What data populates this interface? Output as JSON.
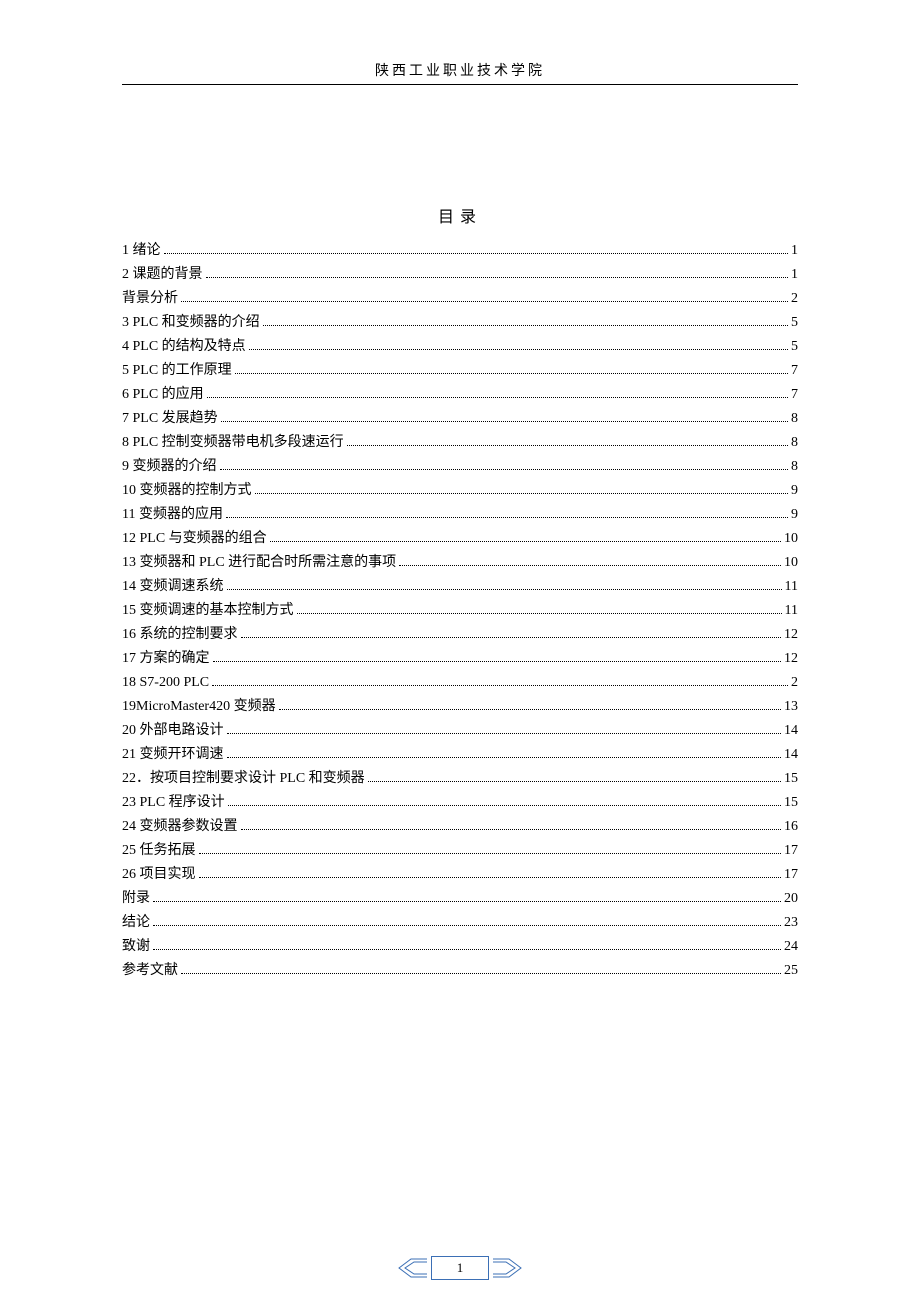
{
  "header": "陕西工业职业技术学院",
  "toc_title": "目录",
  "page_number": "1",
  "toc": [
    {
      "text": "1 绪论",
      "page": "1"
    },
    {
      "text": "2 课题的背景",
      "page": "1"
    },
    {
      "text": "背景分析",
      "page": "2"
    },
    {
      "text": "3 PLC 和变频器的介绍",
      "page": "5"
    },
    {
      "text": "4 PLC 的结构及特点",
      "page": "5"
    },
    {
      "text": "5 PLC 的工作原理",
      "page": "7"
    },
    {
      "text": "6 PLC 的应用",
      "page": "7"
    },
    {
      "text": "7 PLC 发展趋势",
      "page": "8"
    },
    {
      "text": "8 PLC 控制变频器带电机多段速运行",
      "page": "8"
    },
    {
      "text": "9 变频器的介绍",
      "page": "8"
    },
    {
      "text": "10 变频器的控制方式",
      "page": "9"
    },
    {
      "text": "11 变频器的应用",
      "page": "9"
    },
    {
      "text": "12 PLC 与变频器的组合",
      "page": "10"
    },
    {
      "text": "13 变频器和 PLC 进行配合时所需注意的事项",
      "page": "10"
    },
    {
      "text": "14 变频调速系统",
      "page": "11"
    },
    {
      "text": "15 变频调速的基本控制方式",
      "page": "11"
    },
    {
      "text": "16 系统的控制要求",
      "page": "12"
    },
    {
      "text": "17 方案的确定",
      "page": "12"
    },
    {
      "text": "18 S7-200 PLC",
      "page": "2"
    },
    {
      "text": "19MicroMaster420 变频器",
      "page": "13"
    },
    {
      "text": "20 外部电路设计",
      "page": "14"
    },
    {
      "text": "21 变频开环调速",
      "page": "14"
    },
    {
      "text": "22．按项目控制要求设计 PLC 和变频器",
      "page": "15"
    },
    {
      "text": "23 PLC 程序设计",
      "page": "15"
    },
    {
      "text": "24 变频器参数设置",
      "page": "16"
    },
    {
      "text": "25 任务拓展",
      "page": "17"
    },
    {
      "text": "26 项目实现",
      "page": "17"
    },
    {
      "text": "附录",
      "page": "20"
    },
    {
      "text": "结论",
      "page": "23"
    },
    {
      "text": "致谢",
      "page": "24"
    },
    {
      "text": "参考文献",
      "page": "25"
    }
  ]
}
